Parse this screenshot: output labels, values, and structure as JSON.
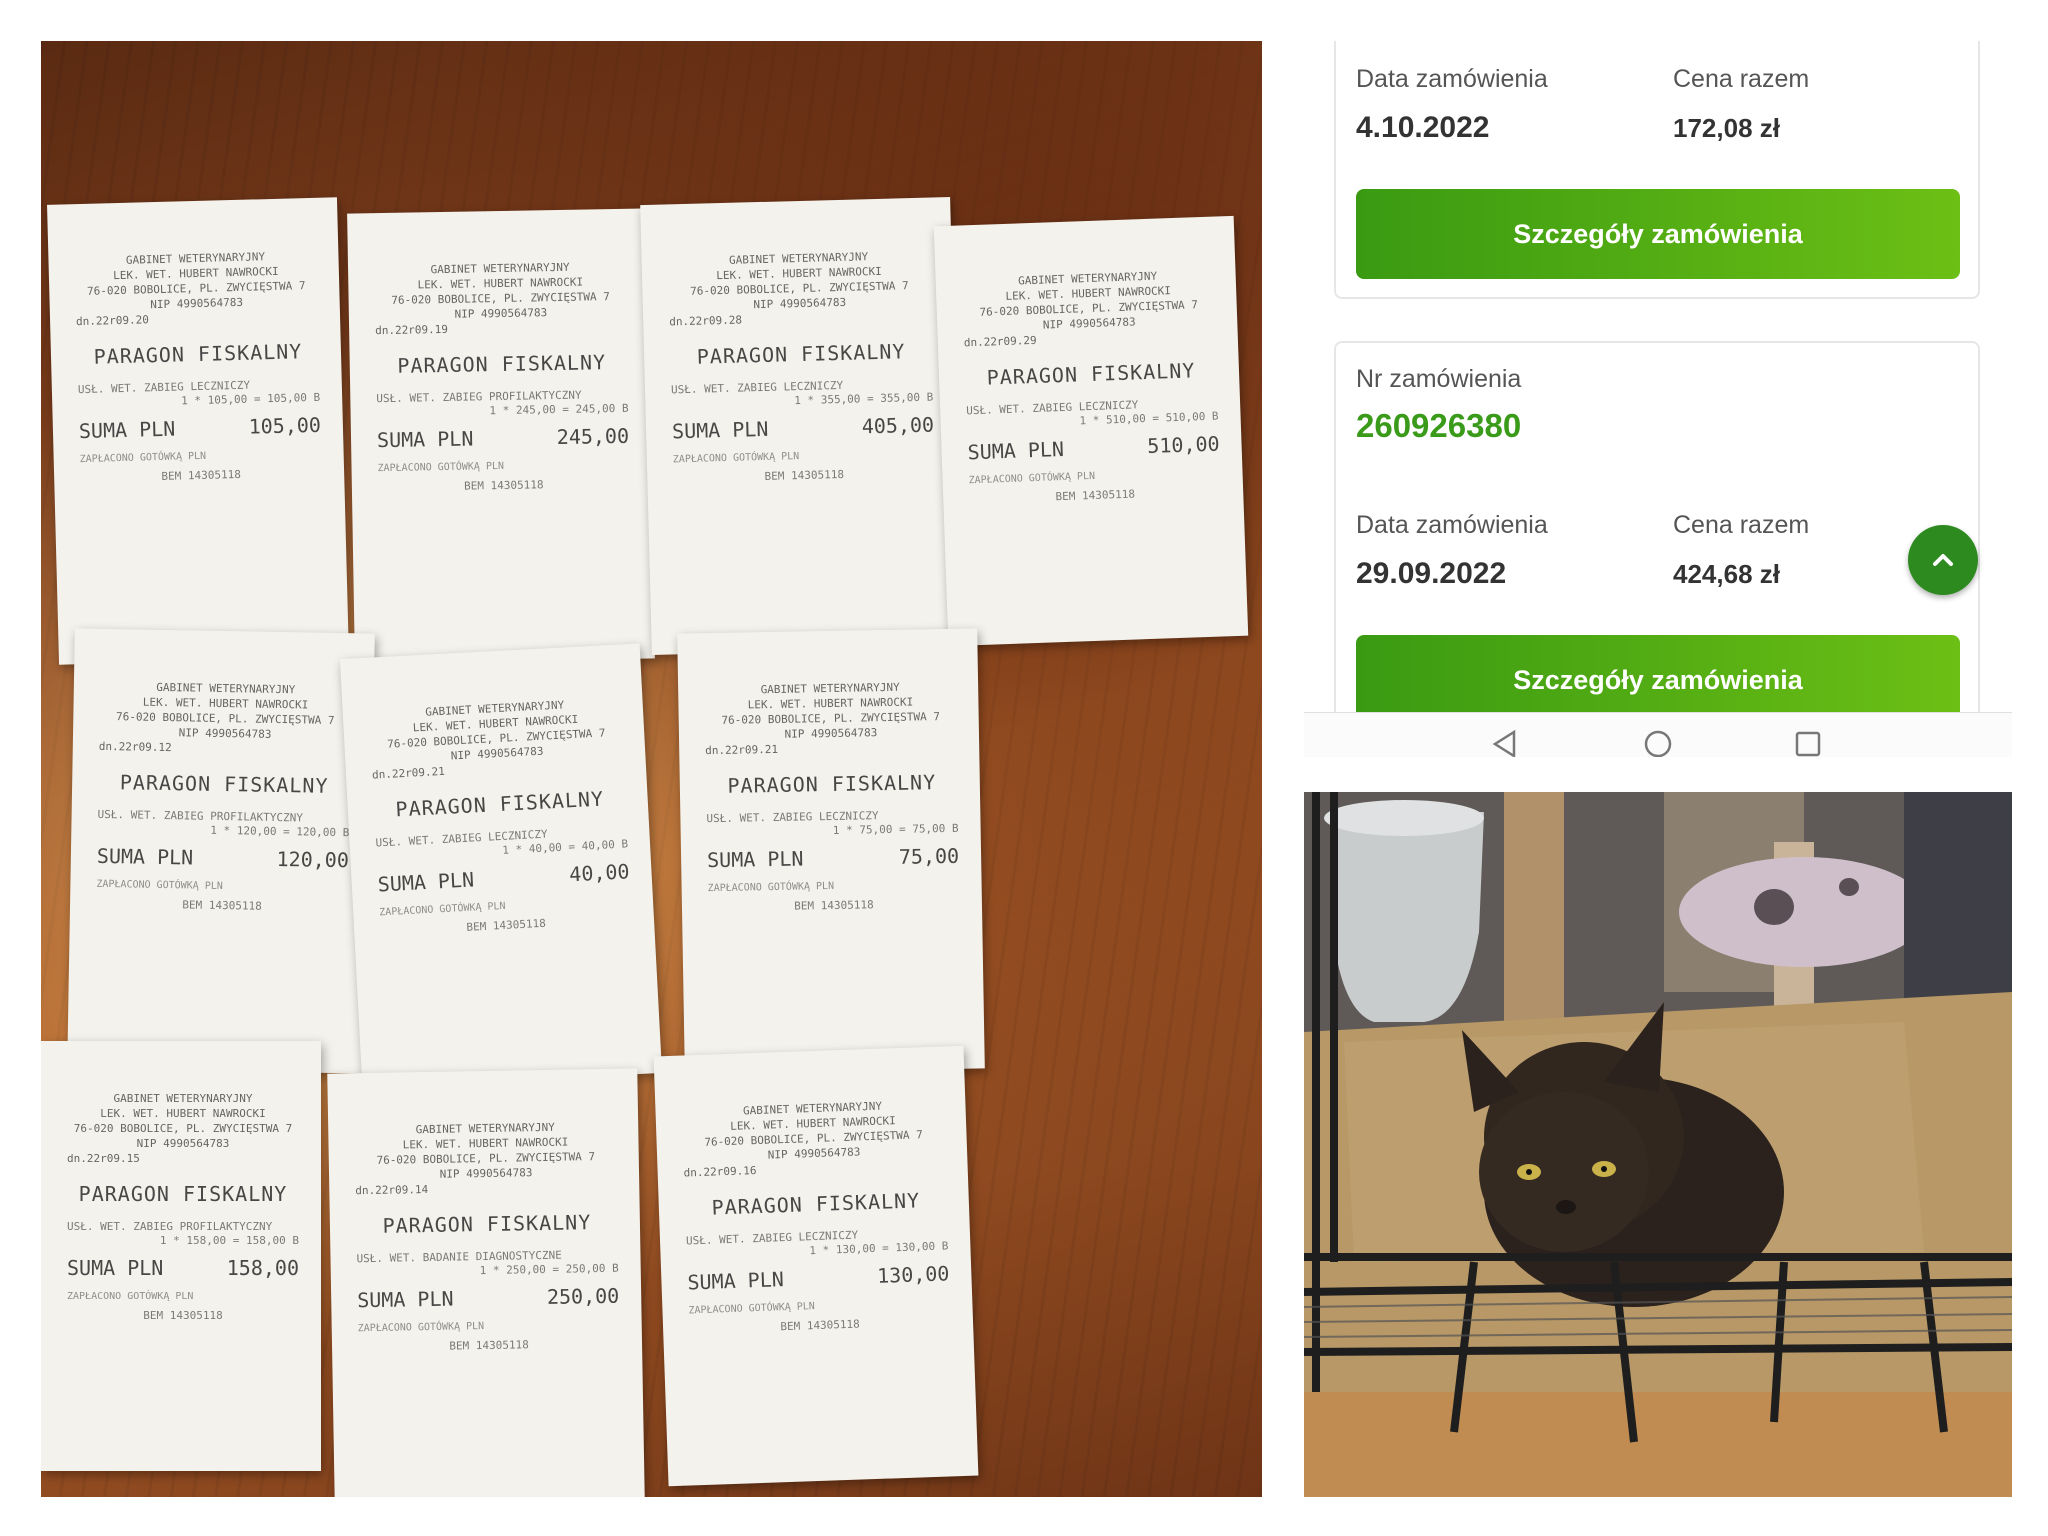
{
  "receipts": [
    {
      "line1": "GABINET WETERYNARYJNY",
      "line2": "LEK. WET. HUBERT NAWROCKI",
      "line3": "76-020 BOBOLICE, PL. ZWYCIĘSTWA 7",
      "nip": "NIP 4990564783",
      "date": "dn.22r09.20",
      "title": "PARAGON FISKALNY",
      "item": "USŁ. WET. ZABIEG LECZNICZY",
      "calc": "1 * 105,00 = 105,00 B",
      "sum_label": "SUMA PLN",
      "sum_value": "105,00",
      "paid": "ZAPŁACONO GOTÓWKĄ PLN",
      "serial": "BEM 14305118"
    },
    {
      "line1": "GABINET WETERYNARYJNY",
      "line2": "LEK. WET. HUBERT NAWROCKI",
      "line3": "76-020 BOBOLICE, PL. ZWYCIĘSTWA 7",
      "nip": "NIP 4990564783",
      "date": "dn.22r09.19",
      "title": "PARAGON FISKALNY",
      "item": "USŁ. WET. ZABIEG PROFILAKTYCZNY",
      "calc": "1 * 245,00 = 245,00 B",
      "sum_label": "SUMA PLN",
      "sum_value": "245,00",
      "paid": "ZAPŁACONO GOTÓWKĄ PLN",
      "serial": "BEM 14305118"
    },
    {
      "line1": "GABINET WETERYNARYJNY",
      "line2": "LEK. WET. HUBERT NAWROCKI",
      "line3": "76-020 BOBOLICE, PL. ZWYCIĘSTWA 7",
      "nip": "NIP 4990564783",
      "date": "dn.22r09.28",
      "title": "PARAGON FISKALNY",
      "item": "USŁ. WET. ZABIEG LECZNICZY",
      "calc": "1 * 355,00 = 355,00 B",
      "sum_label": "SUMA PLN",
      "sum_value": "405,00",
      "paid": "ZAPŁACONO GOTÓWKĄ PLN",
      "serial": "BEM 14305118"
    },
    {
      "line1": "GABINET WETERYNARYJNY",
      "line2": "LEK. WET. HUBERT NAWROCKI",
      "line3": "76-020 BOBOLICE, PL. ZWYCIĘSTWA 7",
      "nip": "NIP 4990564783",
      "date": "dn.22r09.29",
      "title": "PARAGON FISKALNY",
      "item": "USŁ. WET. ZABIEG LECZNICZY",
      "calc": "1 * 510,00 = 510,00 B",
      "sum_label": "SUMA PLN",
      "sum_value": "510,00",
      "paid": "ZAPŁACONO GOTÓWKĄ PLN",
      "serial": "BEM 14305118"
    },
    {
      "line1": "GABINET WETERYNARYJNY",
      "line2": "LEK. WET. HUBERT NAWROCKI",
      "line3": "76-020 BOBOLICE, PL. ZWYCIĘSTWA 7",
      "nip": "NIP 4990564783",
      "date": "dn.22r09.12",
      "title": "PARAGON FISKALNY",
      "item": "USŁ. WET. ZABIEG PROFILAKTYCZNY",
      "calc": "1 * 120,00 = 120,00 B",
      "sum_label": "SUMA PLN",
      "sum_value": "120,00",
      "paid": "ZAPŁACONO GOTÓWKĄ PLN",
      "serial": "BEM 14305118"
    },
    {
      "line1": "GABINET WETERYNARYJNY",
      "line2": "LEK. WET. HUBERT NAWROCKI",
      "line3": "76-020 BOBOLICE, PL. ZWYCIĘSTWA 7",
      "nip": "NIP 4990564783",
      "date": "dn.22r09.21",
      "title": "PARAGON FISKALNY",
      "item": "USŁ. WET. ZABIEG LECZNICZY",
      "calc": "1 * 40,00 = 40,00 B",
      "sum_label": "SUMA PLN",
      "sum_value": "40,00",
      "paid": "ZAPŁACONO GOTÓWKĄ PLN",
      "serial": "BEM 14305118"
    },
    {
      "line1": "GABINET WETERYNARYJNY",
      "line2": "LEK. WET. HUBERT NAWROCKI",
      "line3": "76-020 BOBOLICE, PL. ZWYCIĘSTWA 7",
      "nip": "NIP 4990564783",
      "date": "dn.22r09.21",
      "title": "PARAGON FISKALNY",
      "item": "USŁ. WET. ZABIEG LECZNICZY",
      "calc": "1 * 75,00 = 75,00 B",
      "sum_label": "SUMA PLN",
      "sum_value": "75,00",
      "paid": "ZAPŁACONO GOTÓWKĄ PLN",
      "serial": "BEM 14305118"
    },
    {
      "line1": "GABINET WETERYNARYJNY",
      "line2": "LEK. WET. HUBERT NAWROCKI",
      "line3": "76-020 BOBOLICE, PL. ZWYCIĘSTWA 7",
      "nip": "NIP 4990564783",
      "date": "dn.22r09.15",
      "title": "PARAGON FISKALNY",
      "item": "USŁ. WET. ZABIEG PROFILAKTYCZNY",
      "calc": "1 * 158,00 = 158,00 B",
      "sum_label": "SUMA PLN",
      "sum_value": "158,00",
      "paid": "ZAPŁACONO GOTÓWKĄ PLN",
      "serial": "BEM 14305118"
    },
    {
      "line1": "GABINET WETERYNARYJNY",
      "line2": "LEK. WET. HUBERT NAWROCKI",
      "line3": "76-020 BOBOLICE, PL. ZWYCIĘSTWA 7",
      "nip": "NIP 4990564783",
      "date": "dn.22r09.14",
      "title": "PARAGON FISKALNY",
      "item": "USŁ. WET. BADANIE DIAGNOSTYCZNE",
      "calc": "1 * 250,00 = 250,00 B",
      "sum_label": "SUMA PLN",
      "sum_value": "250,00",
      "paid": "ZAPŁACONO GOTÓWKĄ PLN",
      "serial": "BEM 14305118"
    },
    {
      "line1": "GABINET WETERYNARYJNY",
      "line2": "LEK. WET. HUBERT NAWROCKI",
      "line3": "76-020 BOBOLICE, PL. ZWYCIĘSTWA 7",
      "nip": "NIP 4990564783",
      "date": "dn.22r09.16",
      "title": "PARAGON FISKALNY",
      "item": "USŁ. WET. ZABIEG LECZNICZY",
      "calc": "1 * 130,00 = 130,00 B",
      "sum_label": "SUMA PLN",
      "sum_value": "130,00",
      "paid": "ZAPŁACONO GOTÓWKĄ PLN",
      "serial": "BEM 14305118"
    }
  ],
  "orders": {
    "first": {
      "date_label": "Data zamówienia",
      "date_value": "4.10.2022",
      "price_label": "Cena razem",
      "price_value": "172,08 zł",
      "button_label": "Szczegóły zamówienia"
    },
    "second": {
      "number_label": "Nr zamówienia",
      "number_value": "260926380",
      "date_label": "Data zamówienia",
      "date_value": "29.09.2022",
      "price_label": "Cena razem",
      "price_value": "424,68 zł",
      "button_label": "Szczegóły zamówienia"
    }
  },
  "icons": {
    "scroll_top": "chevron-up-icon",
    "nav_back": "back-triangle-icon",
    "nav_home": "home-circle-icon",
    "nav_recents": "recents-square-icon"
  },
  "colors": {
    "accent_green": "#3a9a1a",
    "button_gradient_start": "#3a9a12",
    "button_gradient_end": "#6cbf14",
    "fab_green": "#2c8a1e"
  }
}
